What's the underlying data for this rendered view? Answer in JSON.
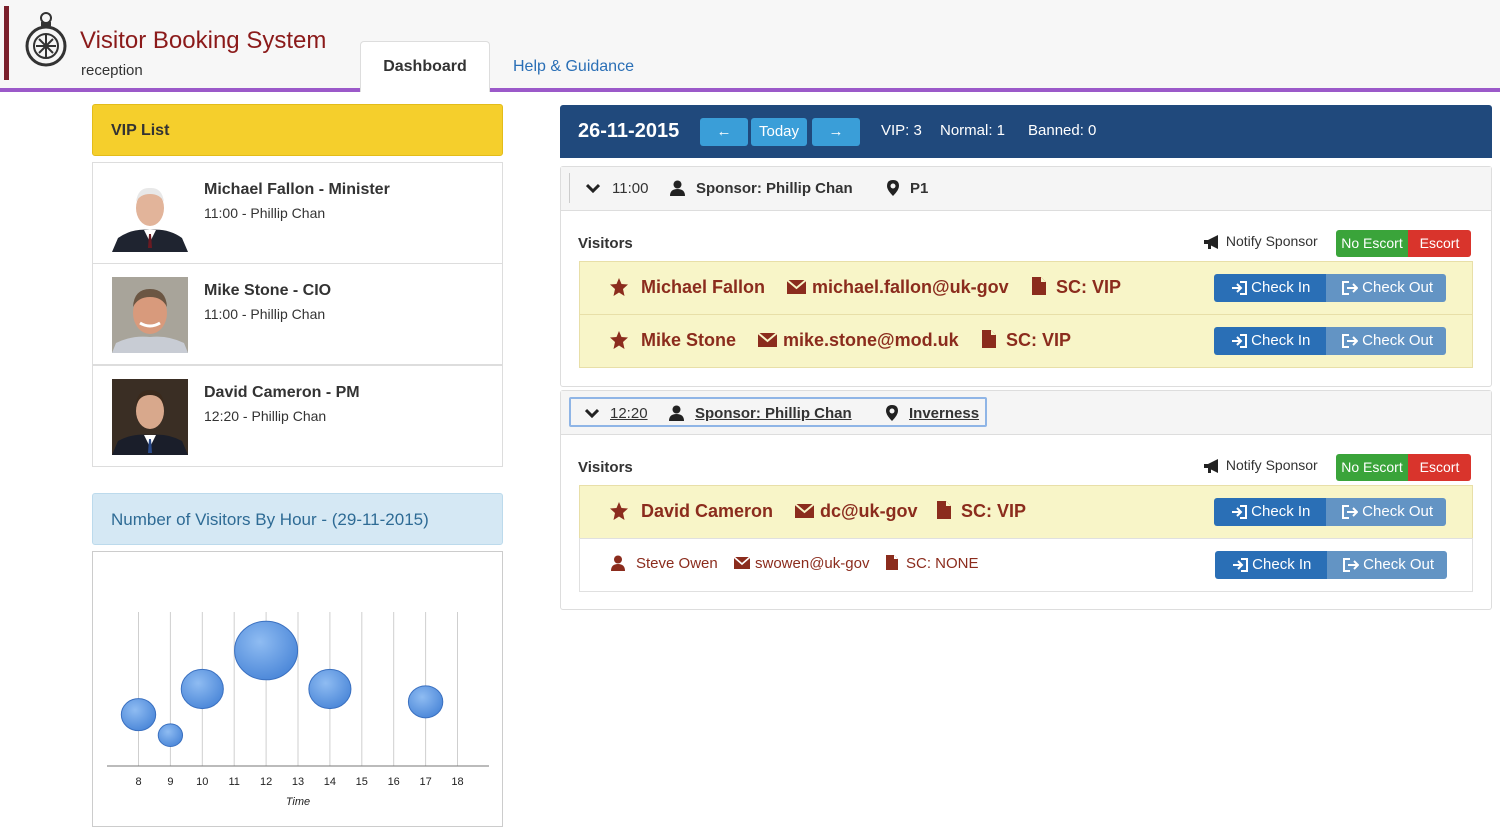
{
  "app": {
    "title": "Visitor Booking System",
    "subtitle": "reception"
  },
  "tabs": [
    {
      "label": "Dashboard",
      "active": true
    },
    {
      "label": "Help & Guidance",
      "active": false
    }
  ],
  "vip_list": {
    "title": "VIP List",
    "items": [
      {
        "name": "Michael Fallon - Minister",
        "time": "11:00 - Phillip Chan"
      },
      {
        "name": "Mike Stone - CIO",
        "time": "11:00 - Phillip Chan"
      },
      {
        "name": "David Cameron - PM",
        "time": "12:20 - Phillip Chan"
      }
    ]
  },
  "chart_panel": {
    "title": "Number of Visitors By Hour - (29-11-2015)"
  },
  "chart_data": {
    "type": "scatter",
    "xlabel": "Time",
    "ylabel": "",
    "categories": [
      "8",
      "9",
      "10",
      "11",
      "12",
      "13",
      "14",
      "15",
      "16",
      "17",
      "18"
    ],
    "points": [
      {
        "x": 8,
        "y": 2.0,
        "size": 2
      },
      {
        "x": 9,
        "y": 1.2,
        "size": 1
      },
      {
        "x": 10,
        "y": 3.0,
        "size": 3
      },
      {
        "x": 12,
        "y": 4.5,
        "size": 4
      },
      {
        "x": 14,
        "y": 3.0,
        "size": 3
      },
      {
        "x": 17,
        "y": 2.5,
        "size": 2
      }
    ],
    "ylim": [
      0,
      6
    ],
    "grid": true
  },
  "day": {
    "date": "26-11-2015",
    "prev_label": "←",
    "today_label": "Today",
    "next_label": "→",
    "vip_count": "VIP: 3",
    "normal_count": "Normal: 1",
    "banned_count": "Banned: 0"
  },
  "bookings": [
    {
      "time": "11:00",
      "sponsor": "Sponsor: Phillip Chan",
      "location": "P1",
      "visitors_label": "Visitors",
      "notify_label": "Notify Sponsor",
      "no_escort_label": "No Escort",
      "escort_label": "Escort",
      "visitors": [
        {
          "name": "Michael Fallon",
          "email": "michael.fallon@uk-gov",
          "clearance": "SC: VIP",
          "vip": true,
          "checkin": "Check In",
          "checkout": "Check Out"
        },
        {
          "name": "Mike Stone",
          "email": "mike.stone@mod.uk",
          "clearance": "SC: VIP",
          "vip": true,
          "checkin": "Check In",
          "checkout": "Check Out"
        }
      ]
    },
    {
      "time": "12:20",
      "sponsor": "Sponsor: Phillip Chan",
      "location": "Inverness",
      "visitors_label": "Visitors",
      "notify_label": "Notify Sponsor",
      "no_escort_label": "No Escort",
      "escort_label": "Escort",
      "visitors": [
        {
          "name": "David Cameron",
          "email": "dc@uk-gov",
          "clearance": "SC: VIP",
          "vip": true,
          "checkin": "Check In",
          "checkout": "Check Out"
        },
        {
          "name": "Steve Owen",
          "email": "swowen@uk-gov",
          "clearance": "SC: NONE",
          "vip": false,
          "checkin": "Check In",
          "checkout": "Check Out"
        }
      ]
    }
  ],
  "colors": {
    "brand": "#8b1a1a",
    "tab_underline": "#9b59c9",
    "vip_header": "#f5cf2c",
    "date_bar": "#20497c",
    "nav_button": "#3a9ed8",
    "check_in": "#2a6fb6",
    "check_out": "#6394c4",
    "no_escort": "#3aa43a",
    "escort": "#d9342c",
    "vip_row": "#f8f5c8",
    "vip_text": "#8b2c1d",
    "bubble": "#4a86d8"
  }
}
